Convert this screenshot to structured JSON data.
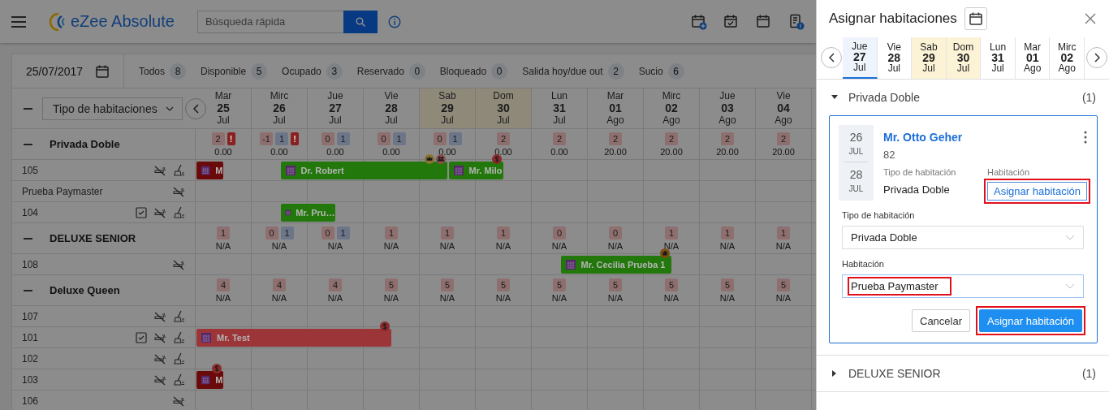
{
  "app": {
    "title": "eZee Absolute"
  },
  "search": {
    "placeholder": "Búsqueda rápida"
  },
  "toolbar_icons": [
    {
      "kind": "calendar-add"
    },
    {
      "kind": "calendar-check"
    },
    {
      "kind": "calendar"
    },
    {
      "kind": "invoice"
    }
  ],
  "filters": {
    "date": "25/07/2017",
    "statuses": [
      {
        "label": "Todos",
        "count": "8"
      },
      {
        "label": "Disponible",
        "count": "5"
      },
      {
        "label": "Ocupado",
        "count": "3"
      },
      {
        "label": "Reservado",
        "count": "0"
      },
      {
        "label": "Bloqueado",
        "count": "0"
      },
      {
        "label": "Salida hoy/due out",
        "count": "2"
      },
      {
        "label": "Sucio",
        "count": "6"
      }
    ]
  },
  "grid": {
    "room_type_dropdown": "Tipo de habitaciones",
    "columns": [
      {
        "day": "Mar",
        "date": "25",
        "month": "Jul",
        "weekend": false
      },
      {
        "day": "Mirc",
        "date": "26",
        "month": "Jul",
        "weekend": false
      },
      {
        "day": "Jue",
        "date": "27",
        "month": "Jul",
        "weekend": false
      },
      {
        "day": "Vie",
        "date": "28",
        "month": "Jul",
        "weekend": false
      },
      {
        "day": "Sab",
        "date": "29",
        "month": "Jul",
        "weekend": true
      },
      {
        "day": "Dom",
        "date": "30",
        "month": "Jul",
        "weekend": true
      },
      {
        "day": "Lun",
        "date": "31",
        "month": "Jul",
        "weekend": false
      },
      {
        "day": "Mar",
        "date": "01",
        "month": "Ago",
        "weekend": false
      },
      {
        "day": "Mirc",
        "date": "02",
        "month": "Ago",
        "weekend": false
      },
      {
        "day": "Jue",
        "date": "03",
        "month": "Ago",
        "weekend": false
      },
      {
        "day": "Vie",
        "date": "04",
        "month": "Ago",
        "weekend": false
      }
    ],
    "groups": [
      {
        "name": "Privada Doble",
        "expanded": true,
        "cells": [
          {
            "badges": [
              {
                "kind": "count",
                "value": "2"
              },
              {
                "kind": "alert",
                "value": "!"
              }
            ],
            "value": "0.00"
          },
          {
            "badges": [
              {
                "kind": "count",
                "value": "-1"
              },
              {
                "kind": "blocked",
                "value": "1"
              },
              {
                "kind": "alert",
                "value": "!"
              }
            ],
            "value": "0.00"
          },
          {
            "badges": [
              {
                "kind": "count",
                "value": "0"
              },
              {
                "kind": "blocked",
                "value": "1"
              }
            ],
            "value": "0.00"
          },
          {
            "badges": [
              {
                "kind": "count",
                "value": "0"
              },
              {
                "kind": "blocked",
                "value": "1"
              }
            ],
            "value": "0.00"
          },
          {
            "badges": [
              {
                "kind": "count",
                "value": "0"
              },
              {
                "kind": "blocked",
                "value": "1"
              }
            ],
            "value": "0.00"
          },
          {
            "badges": [
              {
                "kind": "count",
                "value": "2"
              }
            ],
            "value": "0.00"
          },
          {
            "badges": [
              {
                "kind": "count",
                "value": "2"
              }
            ],
            "value": "0.00"
          },
          {
            "badges": [
              {
                "kind": "count",
                "value": "2"
              }
            ],
            "value": "20.00"
          },
          {
            "badges": [
              {
                "kind": "count",
                "value": "2"
              }
            ],
            "value": "20.00"
          },
          {
            "badges": [
              {
                "kind": "count",
                "value": "2"
              }
            ],
            "value": "20.00"
          },
          {
            "badges": [
              {
                "kind": "count",
                "value": "2"
              }
            ],
            "value": "20.00"
          }
        ],
        "rooms": [
          {
            "name": "105",
            "inspected": false,
            "non_smoking": true,
            "housekeeping": true,
            "days": [
              {
                "kind": "departure",
                "booking": {
                  "guest": "M",
                  "color": "#6b0a0a",
                  "vip": false,
                  "group": false,
                  "payment_due": false,
                  "on_hold": false
                }
              },
              {
                "kind": "arrival",
                "booking": {
                  "guest": "Dr. Robert",
                  "color": "#23780c",
                  "vip": true,
                  "group": true,
                  "payment_due": false,
                  "on_hold": false
                }
              },
              {
                "kind": "stay"
              },
              {
                "kind": "stay"
              },
              {
                "kind": "turnover",
                "booking": {
                  "guest": "Mr. Milo",
                  "color": "#23780c",
                  "vip": false,
                  "group": false,
                  "payment_due": true,
                  "on_hold": false
                }
              },
              {
                "kind": "departure"
              },
              {
                "kind": "free"
              },
              {
                "kind": "free"
              },
              {
                "kind": "free"
              },
              {
                "kind": "free"
              },
              {
                "kind": "free"
              }
            ]
          },
          {
            "name": "Prueba Paymaster",
            "inspected": false,
            "non_smoking": true,
            "housekeeping": false
          },
          {
            "name": "104",
            "inspected": true,
            "non_smoking": true,
            "housekeeping": true,
            "days": [
              {
                "kind": "free"
              },
              {
                "kind": "arrival",
                "booking": {
                  "guest": "Mr. Pru…",
                  "color": "#23780c",
                  "vip": false,
                  "group": false,
                  "payment_due": false,
                  "on_hold": false
                }
              },
              {
                "kind": "departure"
              },
              {
                "kind": "free"
              },
              {
                "kind": "free"
              },
              {
                "kind": "free"
              },
              {
                "kind": "free"
              },
              {
                "kind": "free"
              },
              {
                "kind": "free"
              },
              {
                "kind": "free"
              },
              {
                "kind": "free"
              }
            ]
          }
        ]
      },
      {
        "name": "DELUXE SENIOR",
        "expanded": true,
        "cells": [
          {
            "badges": [
              {
                "kind": "count",
                "value": "1"
              }
            ],
            "value": "N/A"
          },
          {
            "badges": [
              {
                "kind": "count",
                "value": "0"
              },
              {
                "kind": "blocked",
                "value": "1"
              }
            ],
            "value": "N/A"
          },
          {
            "badges": [
              {
                "kind": "count",
                "value": "0"
              },
              {
                "kind": "blocked",
                "value": "1"
              }
            ],
            "value": "N/A"
          },
          {
            "badges": [
              {
                "kind": "count",
                "value": "1"
              }
            ],
            "value": "N/A"
          },
          {
            "badges": [
              {
                "kind": "count",
                "value": "1"
              }
            ],
            "value": "N/A"
          },
          {
            "badges": [
              {
                "kind": "count",
                "value": "1"
              }
            ],
            "value": "N/A"
          },
          {
            "badges": [
              {
                "kind": "count",
                "value": "0"
              }
            ],
            "value": "N/A"
          },
          {
            "badges": [
              {
                "kind": "count",
                "value": "0"
              }
            ],
            "value": "N/A"
          },
          {
            "badges": [
              {
                "kind": "count",
                "value": "1"
              }
            ],
            "value": "N/A"
          },
          {
            "badges": [
              {
                "kind": "count",
                "value": "1"
              }
            ],
            "value": "N/A"
          },
          {
            "badges": [
              {
                "kind": "count",
                "value": "1"
              }
            ],
            "value": "N/A"
          }
        ],
        "rooms": [
          {
            "name": "108",
            "inspected": false,
            "non_smoking": true,
            "housekeeping": false,
            "days": [
              {
                "kind": "free"
              },
              {
                "kind": "free"
              },
              {
                "kind": "free"
              },
              {
                "kind": "free"
              },
              {
                "kind": "free"
              },
              {
                "kind": "free"
              },
              {
                "kind": "arrival",
                "booking": {
                  "guest": "Mr. Cecilia Prueba 1",
                  "color": "#23780c",
                  "vip": false,
                  "group": false,
                  "payment_due": false,
                  "on_hold": true
                }
              },
              {
                "kind": "stay"
              },
              {
                "kind": "departure"
              },
              {
                "kind": "free"
              },
              {
                "kind": "free"
              }
            ]
          }
        ]
      },
      {
        "name": "Deluxe Queen",
        "expanded": true,
        "cells": [
          {
            "badges": [
              {
                "kind": "count",
                "value": "4"
              }
            ],
            "value": "N/A"
          },
          {
            "badges": [
              {
                "kind": "count",
                "value": "4"
              }
            ],
            "value": "N/A"
          },
          {
            "badges": [
              {
                "kind": "count",
                "value": "4"
              }
            ],
            "value": "N/A"
          },
          {
            "badges": [
              {
                "kind": "count",
                "value": "5"
              }
            ],
            "value": "N/A"
          },
          {
            "badges": [
              {
                "kind": "count",
                "value": "5"
              }
            ],
            "value": "N/A"
          },
          {
            "badges": [
              {
                "kind": "count",
                "value": "5"
              }
            ],
            "value": "N/A"
          },
          {
            "badges": [
              {
                "kind": "count",
                "value": "5"
              }
            ],
            "value": "N/A"
          },
          {
            "badges": [
              {
                "kind": "count",
                "value": "5"
              }
            ],
            "value": "N/A"
          },
          {
            "badges": [
              {
                "kind": "count",
                "value": "5"
              }
            ],
            "value": "N/A"
          },
          {
            "badges": [
              {
                "kind": "count",
                "value": "5"
              }
            ],
            "value": "N/A"
          },
          {
            "badges": [
              {
                "kind": "count",
                "value": "5"
              }
            ],
            "value": "N/A"
          }
        ],
        "rooms": [
          {
            "name": "107",
            "inspected": false,
            "non_smoking": true,
            "housekeeping": true
          },
          {
            "name": "101",
            "inspected": true,
            "non_smoking": true,
            "housekeeping": true,
            "days": [
              {
                "kind": "stay",
                "booking": {
                  "guest": "Mr. Test",
                  "color": "#9c3538",
                  "vip": false,
                  "group": false,
                  "payment_due": true,
                  "on_hold": false
                }
              },
              {
                "kind": "stay"
              },
              {
                "kind": "stay"
              },
              {
                "kind": "departure"
              },
              {
                "kind": "free"
              },
              {
                "kind": "free"
              },
              {
                "kind": "free"
              },
              {
                "kind": "free"
              },
              {
                "kind": "free"
              },
              {
                "kind": "free"
              },
              {
                "kind": "free"
              }
            ]
          },
          {
            "name": "102",
            "inspected": false,
            "non_smoking": true,
            "housekeeping": true
          },
          {
            "name": "103",
            "inspected": false,
            "non_smoking": true,
            "housekeeping": true,
            "days": [
              {
                "kind": "departure",
                "booking": {
                  "guest": "M",
                  "color": "#6b0a0a",
                  "vip": false,
                  "group": false,
                  "payment_due": true,
                  "on_hold": false
                }
              },
              {
                "kind": "free"
              },
              {
                "kind": "free"
              },
              {
                "kind": "free"
              },
              {
                "kind": "free"
              },
              {
                "kind": "free"
              },
              {
                "kind": "free"
              },
              {
                "kind": "free"
              },
              {
                "kind": "free"
              },
              {
                "kind": "free"
              },
              {
                "kind": "free"
              }
            ]
          },
          {
            "name": "106",
            "inspected": false,
            "non_smoking": true,
            "housekeeping": false
          }
        ]
      }
    ]
  },
  "panel": {
    "title": "Asignar habitaciones",
    "dates": [
      {
        "day": "Jue",
        "date": "27",
        "month": "Jul",
        "selected": true,
        "weekend": false
      },
      {
        "day": "Vie",
        "date": "28",
        "month": "Jul",
        "selected": false,
        "weekend": false
      },
      {
        "day": "Sab",
        "date": "29",
        "month": "Jul",
        "selected": false,
        "weekend": true
      },
      {
        "day": "Dom",
        "date": "30",
        "month": "Jul",
        "selected": false,
        "weekend": true
      },
      {
        "day": "Lun",
        "date": "31",
        "month": "Jul",
        "selected": false,
        "weekend": false
      },
      {
        "day": "Mar",
        "date": "01",
        "month": "Ago",
        "selected": false,
        "weekend": false
      },
      {
        "day": "Mirc",
        "date": "02",
        "month": "Ago",
        "selected": false,
        "weekend": false
      }
    ],
    "sections": [
      {
        "name": "Privada Doble",
        "count": "(1)",
        "expanded": true,
        "reservations": [
          {
            "arrival_day": "26",
            "arrival_month": "JUL",
            "departure_day": "28",
            "departure_month": "JUL",
            "guest": "Mr. Otto Geher",
            "number": "82",
            "room_type_label": "Tipo de habitación",
            "room_type": "Privada Doble",
            "room_label": "Habitación",
            "assign_link": {
              "label": "Asignar habitación",
              "highlighted": true
            },
            "fields": [
              {
                "label": "Tipo de habitación",
                "value": "Privada Doble",
                "focused": false,
                "highlighted": false
              },
              {
                "label": "Habitación",
                "value": "Prueba Paymaster",
                "focused": true,
                "highlighted": true
              }
            ],
            "buttons": [
              {
                "label": "Cancelar",
                "kind": "secondary",
                "highlighted": false
              },
              {
                "label": "Asignar habitación",
                "kind": "primary",
                "highlighted": true
              }
            ]
          }
        ]
      },
      {
        "name": "DELUXE SENIOR",
        "count": "(1)",
        "expanded": false
      }
    ]
  }
}
